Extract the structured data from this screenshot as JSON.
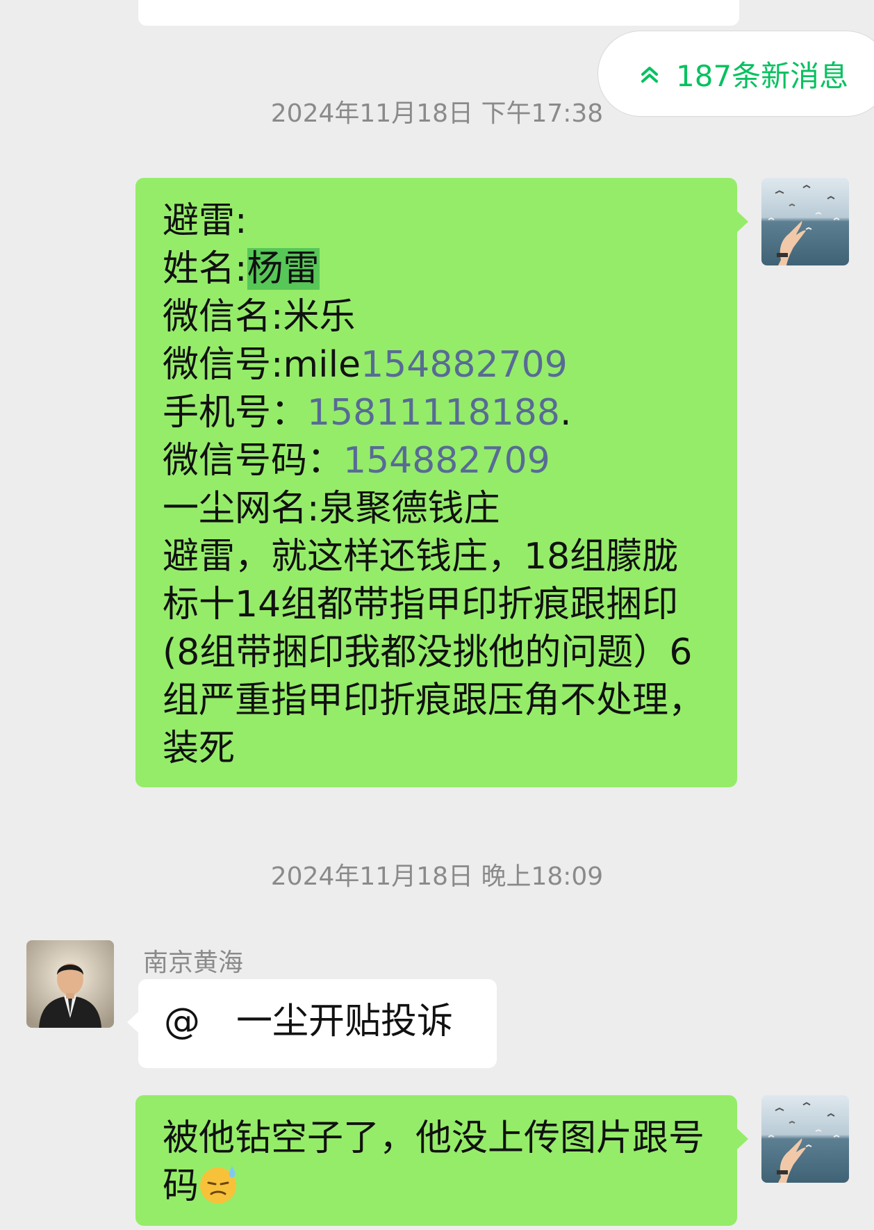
{
  "new_messages": {
    "label": "187条新消息",
    "icon": "double-chevron-up-icon",
    "color": "#07c160"
  },
  "timestamps": [
    "2024年11月18日 下午17:38",
    "2024年11月18日 晚上18:09"
  ],
  "message1": {
    "line1": "避雷:",
    "line2_prefix": "姓名:",
    "line2_name": "杨雷",
    "line3": "微信名:米乐",
    "line4_prefix": "微信号:mile",
    "line4_number": "154882709",
    "line5_prefix": "手机号：",
    "line5_number": "15811118188",
    "line5_suffix": ".",
    "line6_prefix": "微信号码：",
    "line6_number": "154882709",
    "line7": "一尘网名:泉聚德钱庄",
    "line8": "避雷，就这样还钱庄，18组朦胧",
    "line9": "标十14组都带指甲印折痕跟捆印",
    "line10": "(8组带捆印我都没挑他的问题）6",
    "line11": "组严重指甲印折痕跟压角不处理，",
    "line12": "装死"
  },
  "message2": {
    "sender": "南京黄海",
    "text": "@　一尘开贴投诉"
  },
  "message3": {
    "line1": "被他钻空子了，他没上传图片跟号",
    "line2": "码",
    "emoji": "sweat-face-emoji"
  },
  "colors": {
    "background": "#ededed",
    "sent_bubble": "#95ec69",
    "received_bubble": "#ffffff",
    "link_number": "#576b95",
    "timestamp": "#8a8a8a"
  }
}
